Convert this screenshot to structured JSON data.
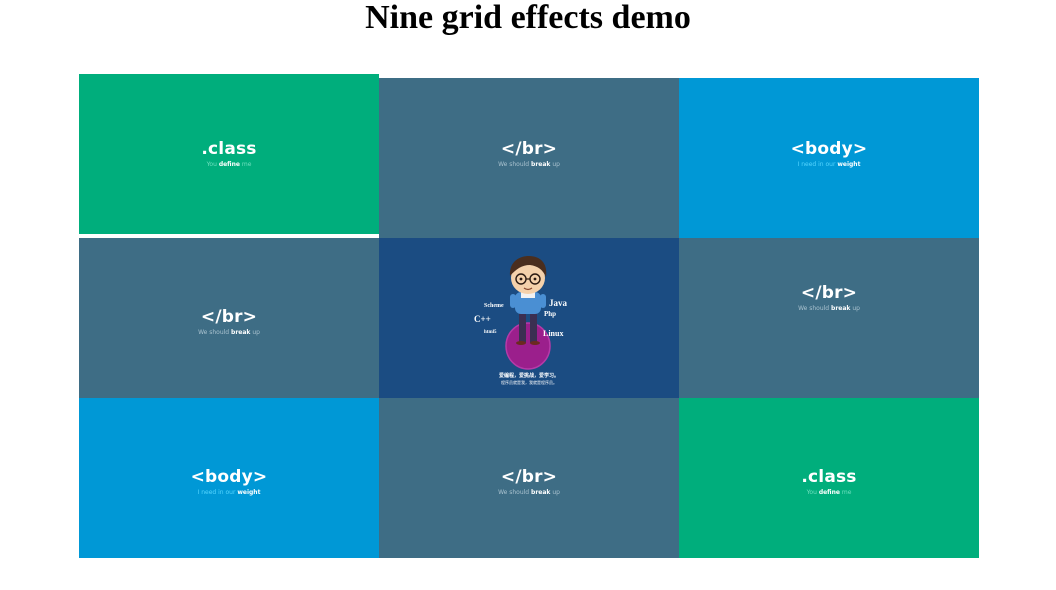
{
  "page": {
    "title": "Nine grid effects demo"
  },
  "tiles": [
    {
      "name": "class",
      "title": ".class",
      "sub_pre": "You ",
      "sub_bold": "define",
      "sub_post": " me"
    },
    {
      "name": "br",
      "title": "</br>",
      "sub_pre": "We should ",
      "sub_bold": "break",
      "sub_post": " up"
    },
    {
      "name": "body",
      "title": "<body>",
      "sub_pre": "I need in our ",
      "sub_bold": "weight",
      "sub_post": ""
    },
    {
      "name": "br",
      "title": "</br>",
      "sub_pre": "We should ",
      "sub_bold": "break",
      "sub_post": " up"
    },
    {
      "name": "center",
      "languages": [
        "Scheme",
        "Java",
        "C++",
        "Php",
        "html5",
        "Linux"
      ],
      "caption_line1": "爱编程，爱挑战，爱学习。",
      "caption_line2": "程序员就是我，我就是程序员。"
    },
    {
      "name": "br",
      "title": "</br>",
      "sub_pre": "We should ",
      "sub_bold": "break",
      "sub_post": " up"
    },
    {
      "name": "body",
      "title": "<body>",
      "sub_pre": "I need in our ",
      "sub_bold": "weight",
      "sub_post": ""
    },
    {
      "name": "br",
      "title": "</br>",
      "sub_pre": "We should ",
      "sub_bold": "break",
      "sub_post": " up"
    },
    {
      "name": "class",
      "title": ".class",
      "sub_pre": "You ",
      "sub_bold": "define",
      "sub_post": " me"
    }
  ],
  "colors": {
    "green": "#00ae7c",
    "slate": "#3e6d85",
    "blue": "#0098d6",
    "navy": "#1b4c82"
  }
}
